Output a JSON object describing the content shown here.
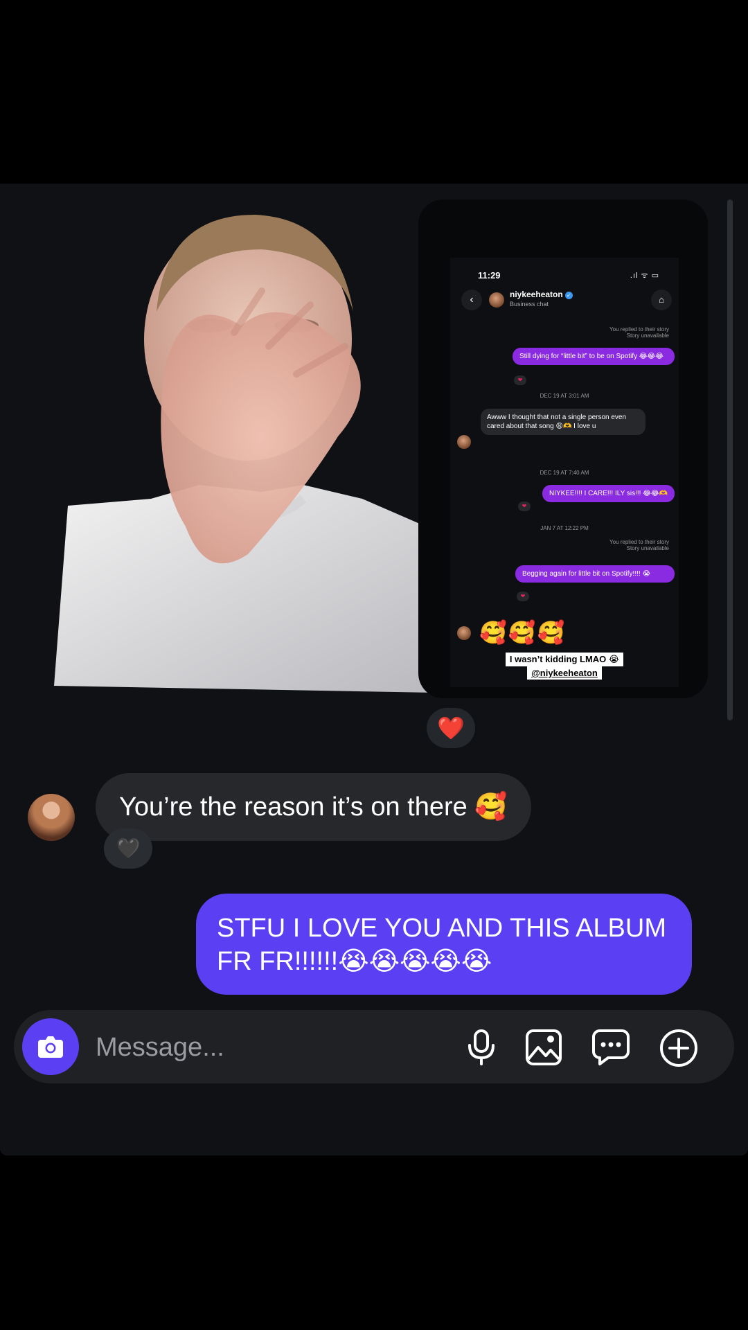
{
  "phone_screenshot": {
    "time": "11:29",
    "status_icons": ".ıl ᯤ ▭",
    "contact_name": "niykeeheaton",
    "contact_subtitle": "Business chat",
    "messages": [
      {
        "meta1": "You replied to their story",
        "meta2": "Story unavailable"
      },
      {
        "text": "Still dying for “little bit” to be on Spotify 😂😂😂"
      },
      {
        "date": "DEC 19 AT 3:01 AM"
      },
      {
        "text": "Awww I thought that not a single person even cared about that song 😩🫶 I love u"
      },
      {
        "date": "DEC 19 AT 7:40 AM"
      },
      {
        "text": "NIYKEE!!!! I CARE!!! ILY sis!!! 😂😂🫶"
      },
      {
        "date": "JAN 7 AT 12:22 PM"
      },
      {
        "meta1": "You replied to their story",
        "meta2": "Story unavailable"
      },
      {
        "text": "Begging again for little bit on Spotify!!!! 😭"
      }
    ],
    "emoji_reply": "🥰🥰🥰",
    "caption_line1": "I wasn’t kidding LMAO 😭",
    "caption_line2": "@niykeeheaton"
  },
  "photo_reaction": "❤️",
  "incoming": {
    "text": "You’re the reason it’s on there 🥰",
    "reaction": "🖤"
  },
  "outgoing": {
    "text": "STFU I LOVE YOU AND THIS ALBUM FR FR!!!!!!😭😭😭😭😭"
  },
  "composer": {
    "placeholder": "Message..."
  },
  "colors": {
    "accent": "#5b3ff2",
    "background": "#0f1115",
    "bubble_incoming": "#26282c"
  }
}
